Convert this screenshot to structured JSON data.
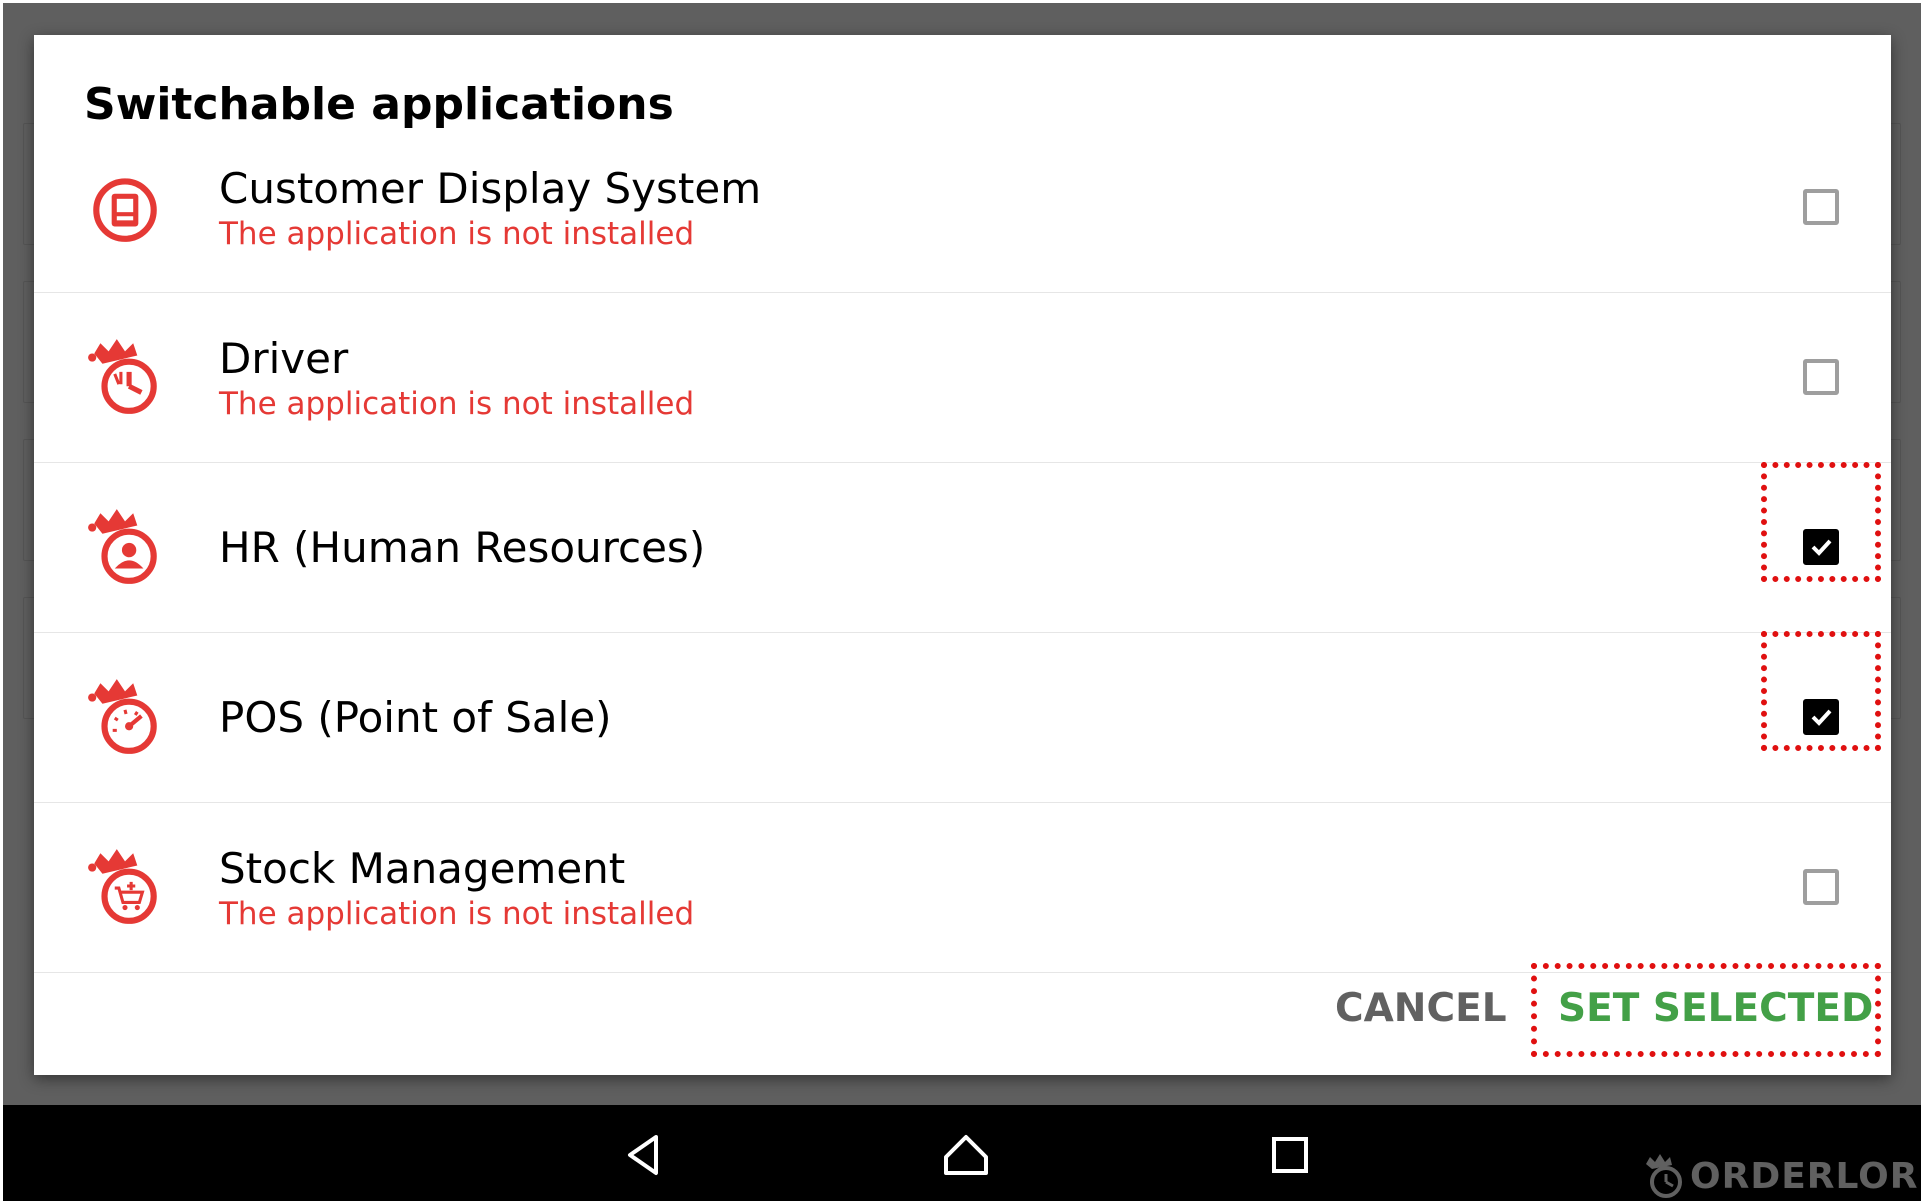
{
  "dialog": {
    "title": "Switchable applications",
    "apps": [
      {
        "name": "Customer Display System",
        "status": "The application is not installed",
        "checked": false,
        "icon": "customer-display-icon"
      },
      {
        "name": "Driver",
        "status": "The application is not installed",
        "checked": false,
        "icon": "driver-clock-icon"
      },
      {
        "name": "HR (Human Resources)",
        "status": "",
        "checked": true,
        "icon": "hr-person-icon"
      },
      {
        "name": "POS (Point of Sale)",
        "status": "",
        "checked": true,
        "icon": "pos-gauge-icon"
      },
      {
        "name": "Stock Management",
        "status": "The application is not installed",
        "checked": false,
        "icon": "stock-cart-icon"
      }
    ],
    "cancel_label": "CANCEL",
    "set_selected_label": "SET SELECTED"
  },
  "navbar": {
    "back_icon": "back-triangle-icon",
    "home_icon": "home-icon",
    "recents_icon": "recents-square-icon"
  },
  "watermark": {
    "text": "ORDERLORD"
  },
  "colors": {
    "accent_red": "#e53935",
    "set_selected_green": "#43a047",
    "highlight_red": "#e01010"
  }
}
